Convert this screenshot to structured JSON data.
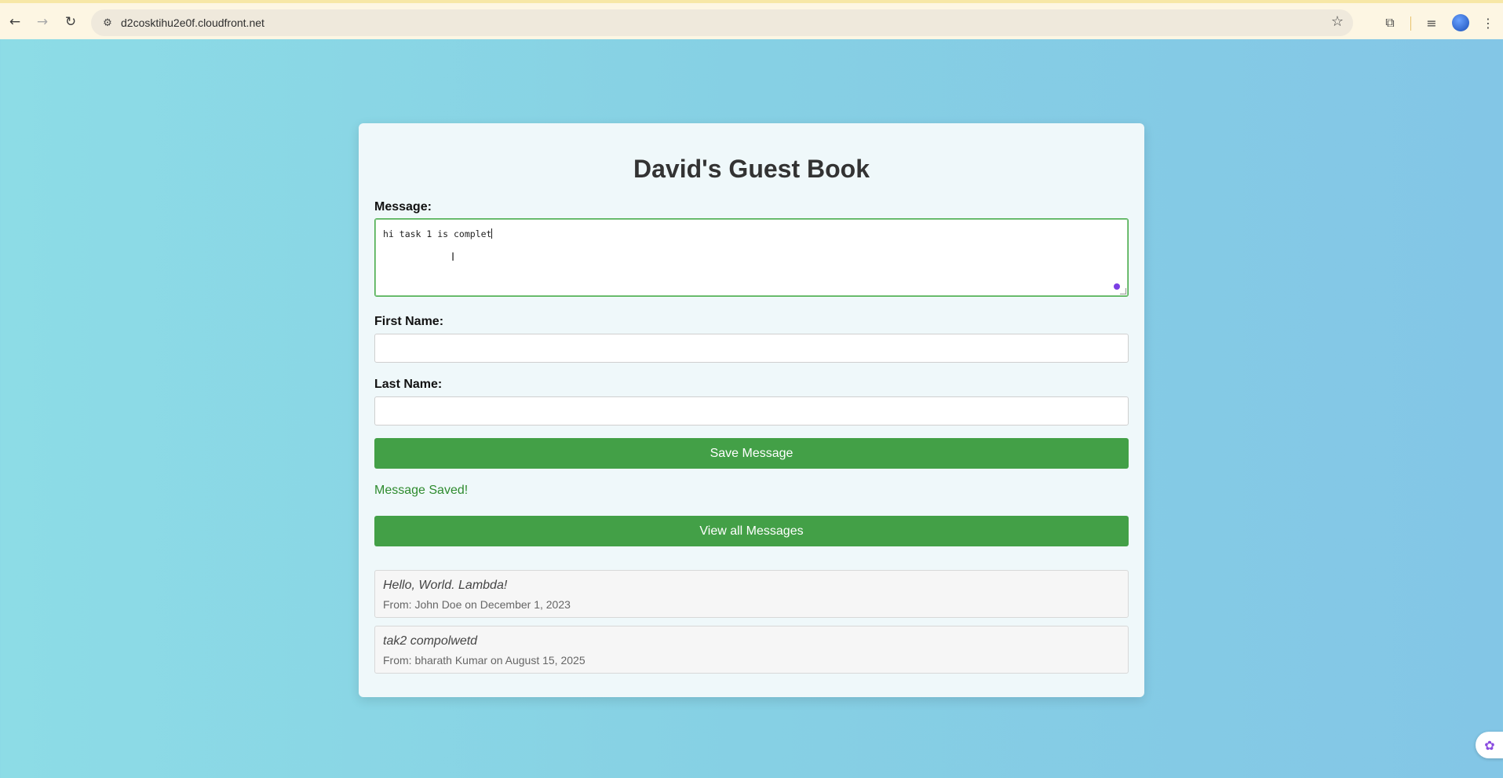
{
  "browser": {
    "url": "d2cosktihu2e0f.cloudfront.net",
    "back_icon": "←",
    "forward_icon": "→",
    "reload_icon": "↻",
    "site_info_icon": "⚙",
    "star_icon": "☆",
    "extensions_icon": "⧉",
    "media_icon": "≡",
    "menu_icon": "⋮"
  },
  "page": {
    "title": "David's Guest Book",
    "message_label": "Message:",
    "message_value": "hi task 1 is complet",
    "first_name_label": "First Name:",
    "first_name_value": "",
    "last_name_label": "Last Name:",
    "last_name_value": "",
    "save_button": "Save Message",
    "status": "Message Saved!",
    "view_all_button": "View all Messages",
    "messages": [
      {
        "text": "Hello, World. Lambda!",
        "meta": "From: John Doe on December 1, 2023"
      },
      {
        "text": "tak2 compolwetd",
        "meta": "From: bharath Kumar on August 15, 2025"
      }
    ]
  },
  "colors": {
    "button_green": "#43a047",
    "status_green": "#2e8b2e",
    "page_background": "#8ddce6"
  }
}
